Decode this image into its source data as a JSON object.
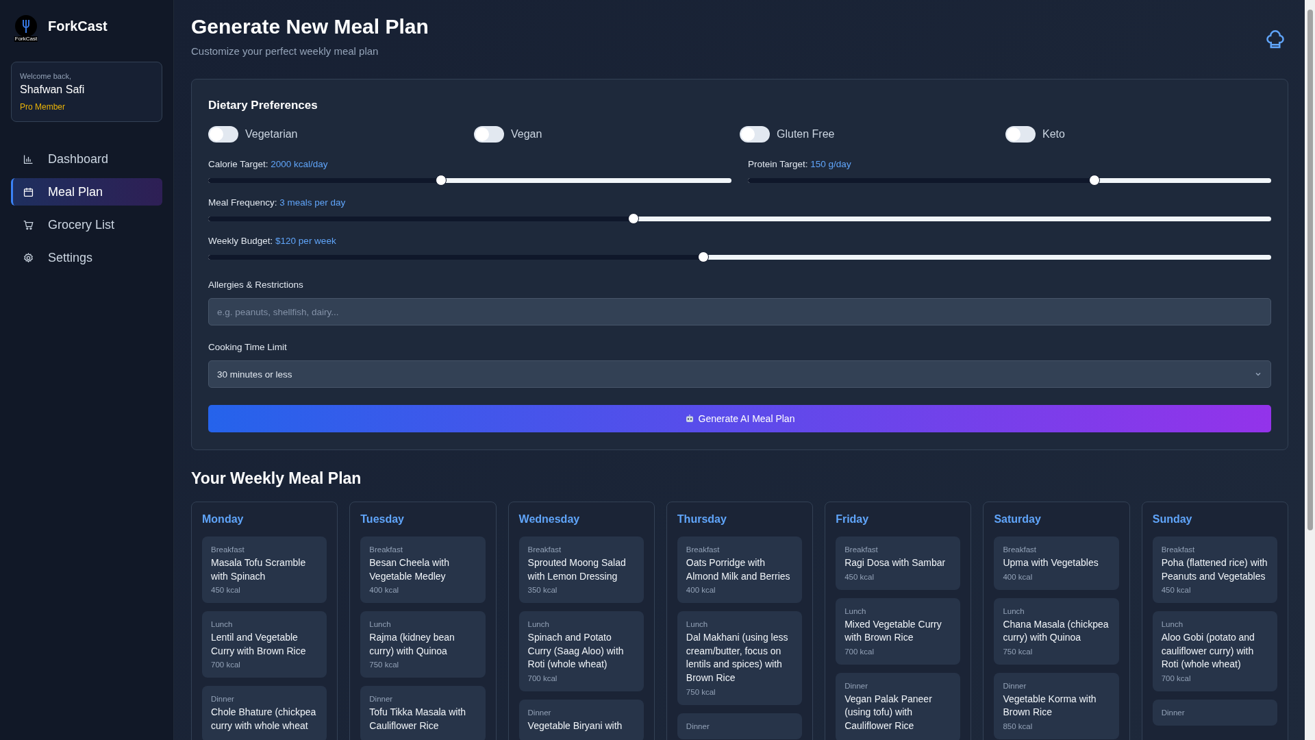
{
  "sidebar": {
    "brand": "ForkCast",
    "logo_caption": "ForkCast",
    "user": {
      "greeting": "Welcome back,",
      "name": "Shafwan Safi",
      "tier": "Pro Member"
    },
    "items": [
      {
        "label": "Dashboard",
        "kind": "chart",
        "selected": false
      },
      {
        "label": "Meal Plan",
        "kind": "calendar",
        "selected": true
      },
      {
        "label": "Grocery List",
        "kind": "cart",
        "selected": false
      },
      {
        "label": "Settings",
        "kind": "gear",
        "selected": false
      }
    ]
  },
  "header": {
    "title": "Generate New Meal Plan",
    "subtitle": "Customize your perfect weekly meal plan"
  },
  "preferences": {
    "title": "Dietary Preferences",
    "toggles": [
      {
        "label": "Vegetarian",
        "on": false
      },
      {
        "label": "Vegan",
        "on": false
      },
      {
        "label": "Gluten Free",
        "on": false
      },
      {
        "label": "Keto",
        "on": false
      }
    ],
    "slider_rows": [
      [
        {
          "label": "Calorie Target:",
          "reading": "2000 kcal/day",
          "level": 0.445
        },
        {
          "label": "Protein Target:",
          "reading": "150 g/day",
          "level": 0.662
        }
      ],
      [
        {
          "label": "Meal Frequency:",
          "reading": "3 meals per day",
          "level": 0.4
        }
      ],
      [
        {
          "label": "Weekly Budget:",
          "reading": "$120 per week",
          "level": 0.466
        }
      ]
    ],
    "allergies": {
      "label": "Allergies & Restrictions",
      "placeholder": "e.g. peanuts, shellfish, dairy..."
    },
    "cooking_time": {
      "label": "Cooking Time Limit",
      "value": "30 minutes or less"
    },
    "generate_button": "Generate AI Meal Plan"
  },
  "weekly_plan": {
    "title": "Your Weekly Meal Plan",
    "days": [
      {
        "day": "Monday",
        "meals": [
          {
            "meal": "Breakfast",
            "name": "Masala Tofu Scramble with Spinach",
            "kcal": "450 kcal"
          },
          {
            "meal": "Lunch",
            "name": "Lentil and Vegetable Curry with Brown Rice",
            "kcal": "700 kcal"
          },
          {
            "meal": "Dinner",
            "name": "Chole Bhature (chickpea curry with whole wheat"
          }
        ]
      },
      {
        "day": "Tuesday",
        "meals": [
          {
            "meal": "Breakfast",
            "name": "Besan Cheela with Vegetable Medley",
            "kcal": "400 kcal"
          },
          {
            "meal": "Lunch",
            "name": "Rajma (kidney bean curry) with Quinoa",
            "kcal": "750 kcal"
          },
          {
            "meal": "Dinner",
            "name": "Tofu Tikka Masala with Cauliflower Rice"
          }
        ]
      },
      {
        "day": "Wednesday",
        "meals": [
          {
            "meal": "Breakfast",
            "name": "Sprouted Moong Salad with Lemon Dressing",
            "kcal": "350 kcal"
          },
          {
            "meal": "Lunch",
            "name": "Spinach and Potato Curry (Saag Aloo) with Roti (whole wheat)",
            "kcal": "700 kcal"
          },
          {
            "meal": "Dinner",
            "name": "Vegetable Biryani with"
          }
        ]
      },
      {
        "day": "Thursday",
        "meals": [
          {
            "meal": "Breakfast",
            "name": "Oats Porridge with Almond Milk and Berries",
            "kcal": "400 kcal"
          },
          {
            "meal": "Lunch",
            "name": "Dal Makhani (using less cream/butter, focus on lentils and spices) with Brown Rice",
            "kcal": "750 kcal"
          },
          {
            "meal": "Dinner"
          }
        ]
      },
      {
        "day": "Friday",
        "meals": [
          {
            "meal": "Breakfast",
            "name": "Ragi Dosa with Sambar",
            "kcal": "450 kcal"
          },
          {
            "meal": "Lunch",
            "name": "Mixed Vegetable Curry with Brown Rice",
            "kcal": "700 kcal"
          },
          {
            "meal": "Dinner",
            "name": "Vegan Palak Paneer (using tofu) with Cauliflower Rice"
          }
        ]
      },
      {
        "day": "Saturday",
        "meals": [
          {
            "meal": "Breakfast",
            "name": "Upma with Vegetables",
            "kcal": "400 kcal"
          },
          {
            "meal": "Lunch",
            "name": "Chana Masala (chickpea curry) with Quinoa",
            "kcal": "750 kcal"
          },
          {
            "meal": "Dinner",
            "name": "Vegetable Korma with Brown Rice",
            "kcal": "850 kcal"
          }
        ]
      },
      {
        "day": "Sunday",
        "meals": [
          {
            "meal": "Breakfast",
            "name": "Poha (flattened rice) with Peanuts and Vegetables",
            "kcal": "450 kcal"
          },
          {
            "meal": "Lunch",
            "name": "Aloo Gobi (potato and cauliflower curry) with Roti (whole wheat)",
            "kcal": "700 kcal"
          },
          {
            "meal": "Dinner"
          }
        ]
      }
    ]
  }
}
